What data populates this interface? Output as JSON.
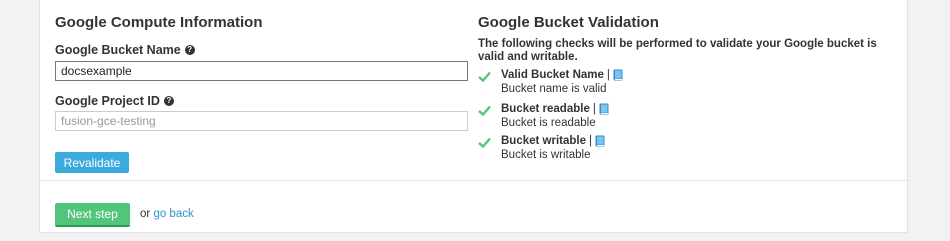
{
  "compute": {
    "title": "Google Compute Information",
    "bucket_name_label": "Google Bucket Name",
    "bucket_name_value": "docsexample",
    "project_id_label": "Google Project ID",
    "project_id_placeholder": "fusion-gce-testing",
    "revalidate_label": "Revalidate"
  },
  "validation": {
    "title": "Google Bucket Validation",
    "description": "The following checks will be performed to validate your Google bucket is valid and writable.",
    "separator": "|",
    "checks": [
      {
        "title": "Valid Bucket Name",
        "status": "Bucket name is valid"
      },
      {
        "title": "Bucket readable",
        "status": "Bucket is readable"
      },
      {
        "title": "Bucket writable",
        "status": "Bucket is writable"
      }
    ]
  },
  "footer": {
    "next_label": "Next step",
    "or_text": "or",
    "back_label": "go back"
  },
  "icons": {
    "help": "question-circle-icon",
    "check": "check-icon",
    "docs": "book-icon"
  },
  "colors": {
    "primary": "#3aabdc",
    "success": "#53c57a",
    "link": "#2a97c8",
    "docs_icon": "#2f8fd0"
  }
}
